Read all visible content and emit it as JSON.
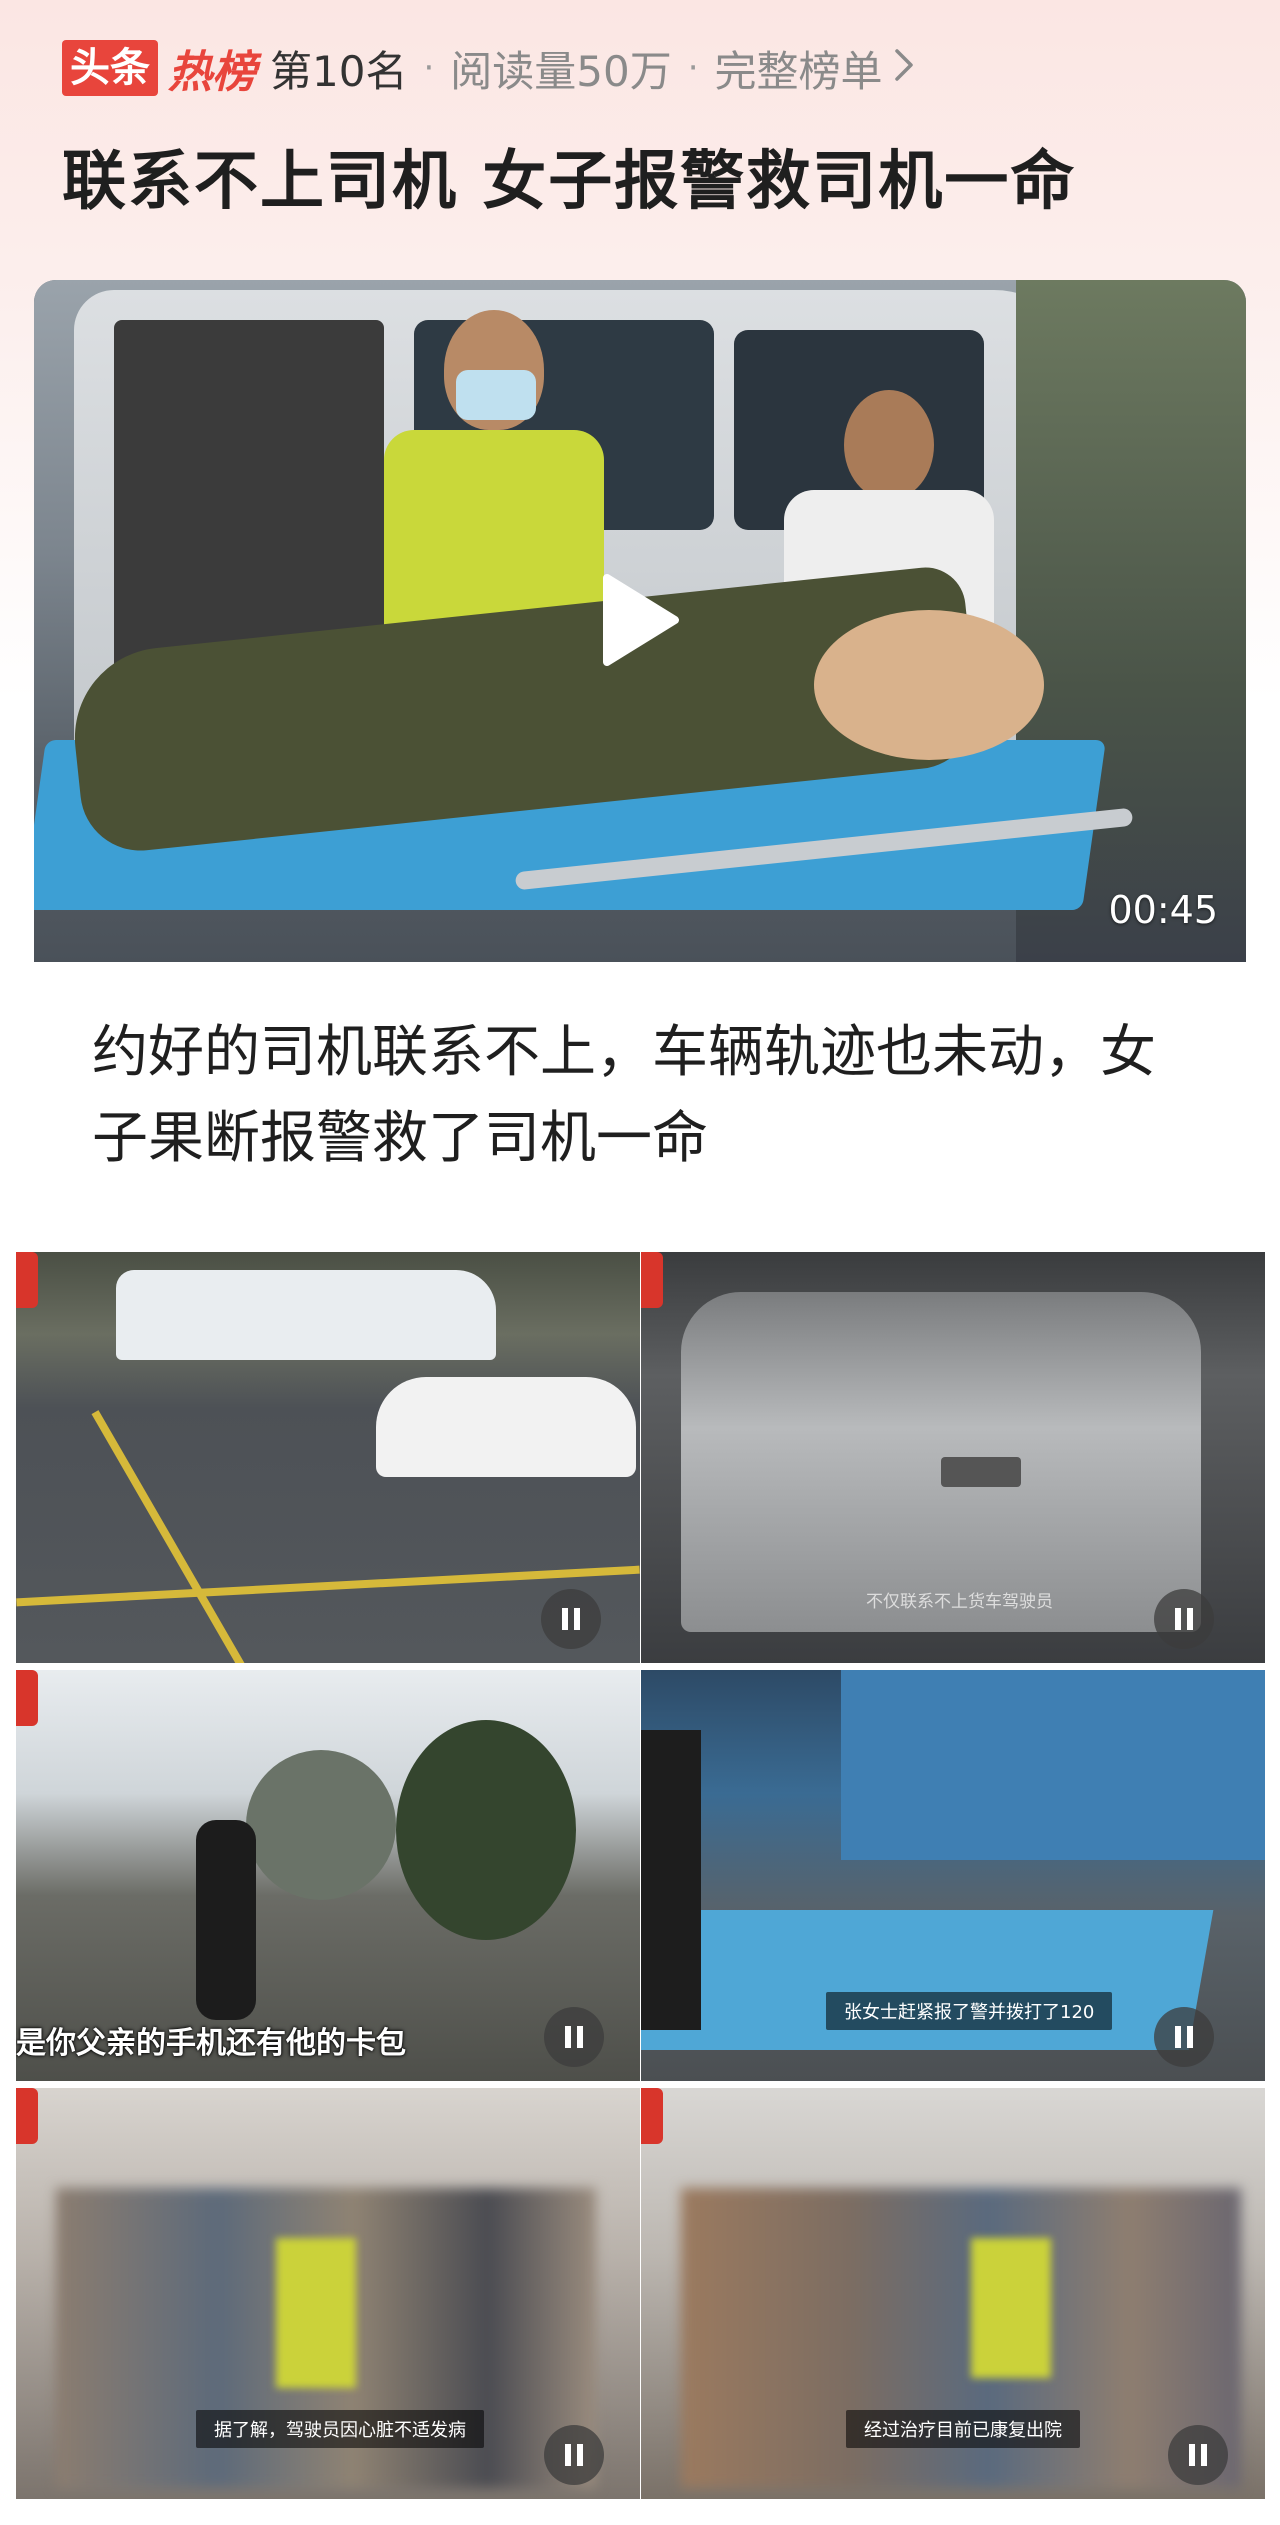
{
  "header": {
    "brand_left": "头条",
    "brand_right": "热榜",
    "rank": "第10名",
    "separator": "·",
    "reads": "阅读量50万",
    "full_list": "完整榜单",
    "chevron_icon": "chevron-right-icon"
  },
  "headline": "联系不上司机 女子报警救司机一命",
  "video": {
    "duration": "00:45",
    "play_icon": "play-icon"
  },
  "summary": "约好的司机联系不上，车辆轨迹也未动，女子果断报警救了司机一命",
  "tiles": [
    {
      "caption": "",
      "pause_icon": "pause-icon"
    },
    {
      "caption": "不仅联系不上货车驾驶员",
      "pause_icon": "pause-icon"
    },
    {
      "caption": "是你父亲的手机还有他的卡包",
      "pause_icon": "pause-icon"
    },
    {
      "caption": "张女士赶紧报了警并拨打了120",
      "pause_icon": "pause-icon"
    },
    {
      "caption": "据了解，驾驶员因心脏不适发病",
      "pause_icon": "pause-icon"
    },
    {
      "caption": "经过治疗目前已康复出院",
      "pause_icon": "pause-icon"
    }
  ],
  "colors": {
    "brand_red": "#e8453c",
    "card_tint": "#fbe6e3",
    "stretcher_blue": "#3d9fd4"
  }
}
